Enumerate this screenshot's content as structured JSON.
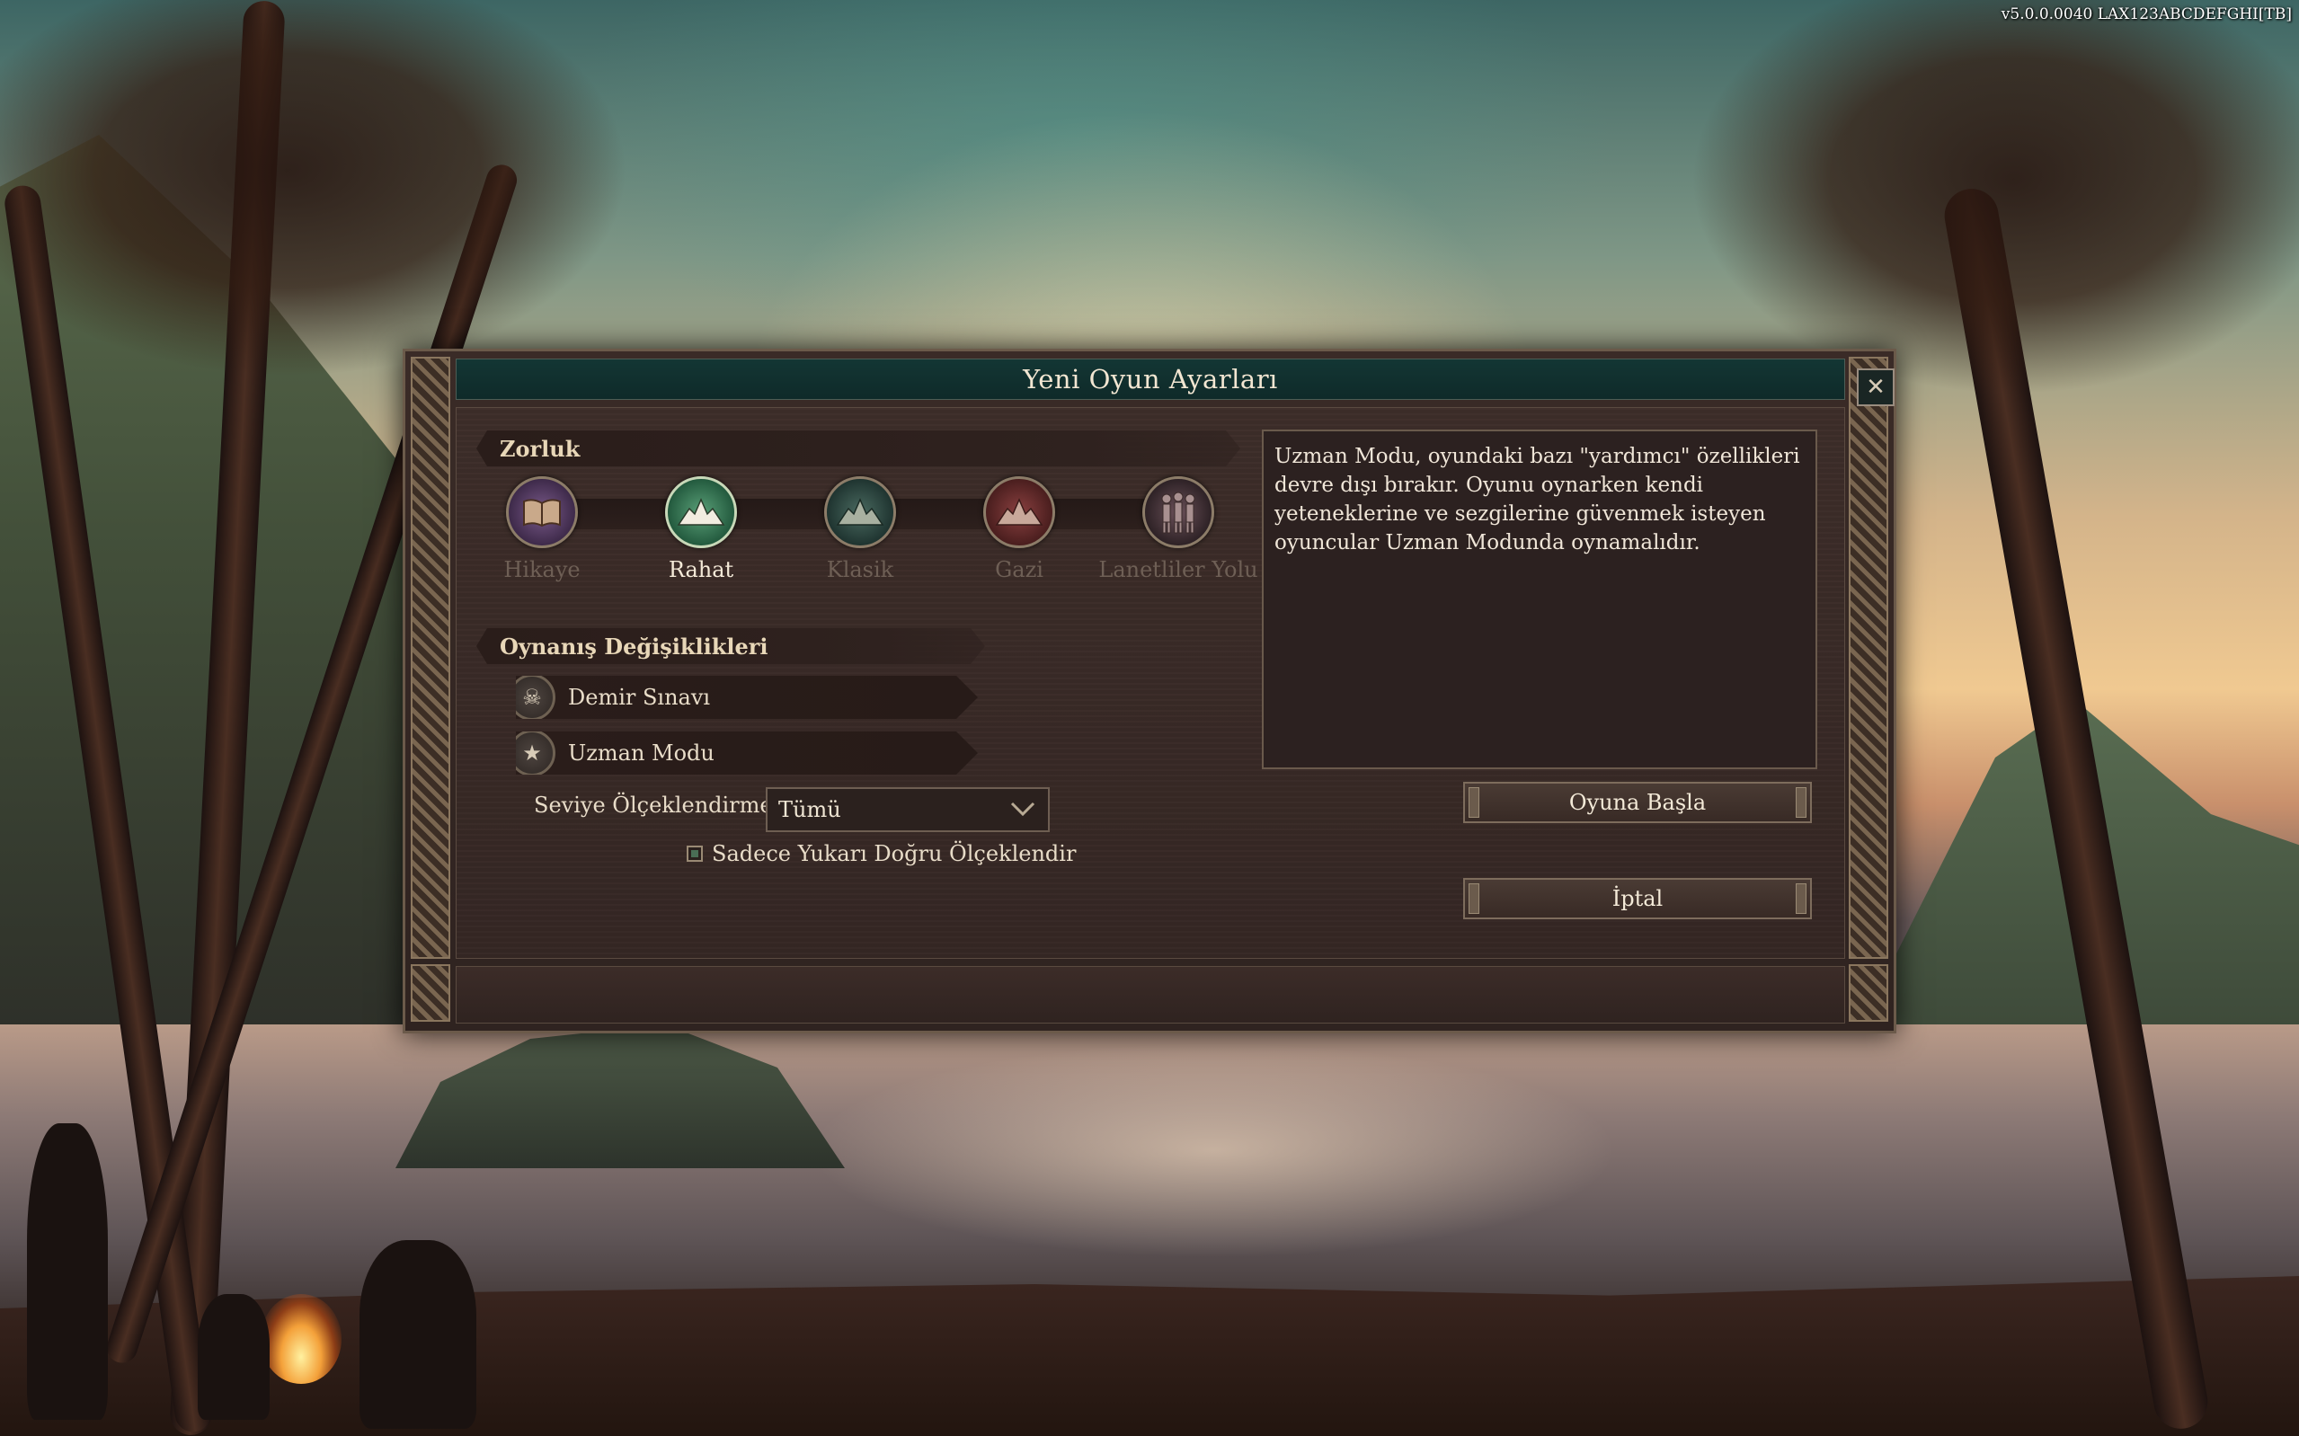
{
  "version": "v5.0.0.0040  LAX123ABCDEFGHI[TB]",
  "dialog": {
    "title": "Yeni Oyun Ayarları",
    "close_symbol": "✕"
  },
  "difficulty": {
    "header": "Zorluk",
    "options": [
      {
        "label": "Hikaye",
        "icon": "book-icon",
        "active": false,
        "color": "#5a3a6a"
      },
      {
        "label": "Rahat",
        "icon": "mountain-icon",
        "active": true,
        "color": "#3e7a5a"
      },
      {
        "label": "Klasik",
        "icon": "mountain-icon",
        "active": false,
        "color": "#35504a"
      },
      {
        "label": "Gazi",
        "icon": "mountain-icon",
        "active": false,
        "color": "#6a3030"
      },
      {
        "label": "Lanetliler Yolu",
        "icon": "skeleton-icon",
        "active": false,
        "color": "#4a3a40"
      }
    ]
  },
  "modifiers": {
    "header": "Oynanış Değişiklikleri",
    "items": [
      {
        "label": "Demir Sınavı",
        "icon": "skull-icon",
        "symbol": "☠"
      },
      {
        "label": "Uzman Modu",
        "icon": "expert-icon",
        "symbol": "★"
      }
    ]
  },
  "level_scaling": {
    "label": "Seviye Ölçeklendirme",
    "value": "Tümü",
    "checkbox_label": "Sadece Yukarı Doğru Ölçeklendir",
    "checked": true
  },
  "description": "Uzman Modu, oyundaki bazı \"yardımcı\" özellikleri devre dışı bırakır. Oyunu oynarken kendi yeteneklerine ve sezgilerine güvenmek isteyen oyuncular Uzman Modunda oynamalıdır.",
  "buttons": {
    "start": "Oyuna Başla",
    "cancel": "İptal"
  }
}
